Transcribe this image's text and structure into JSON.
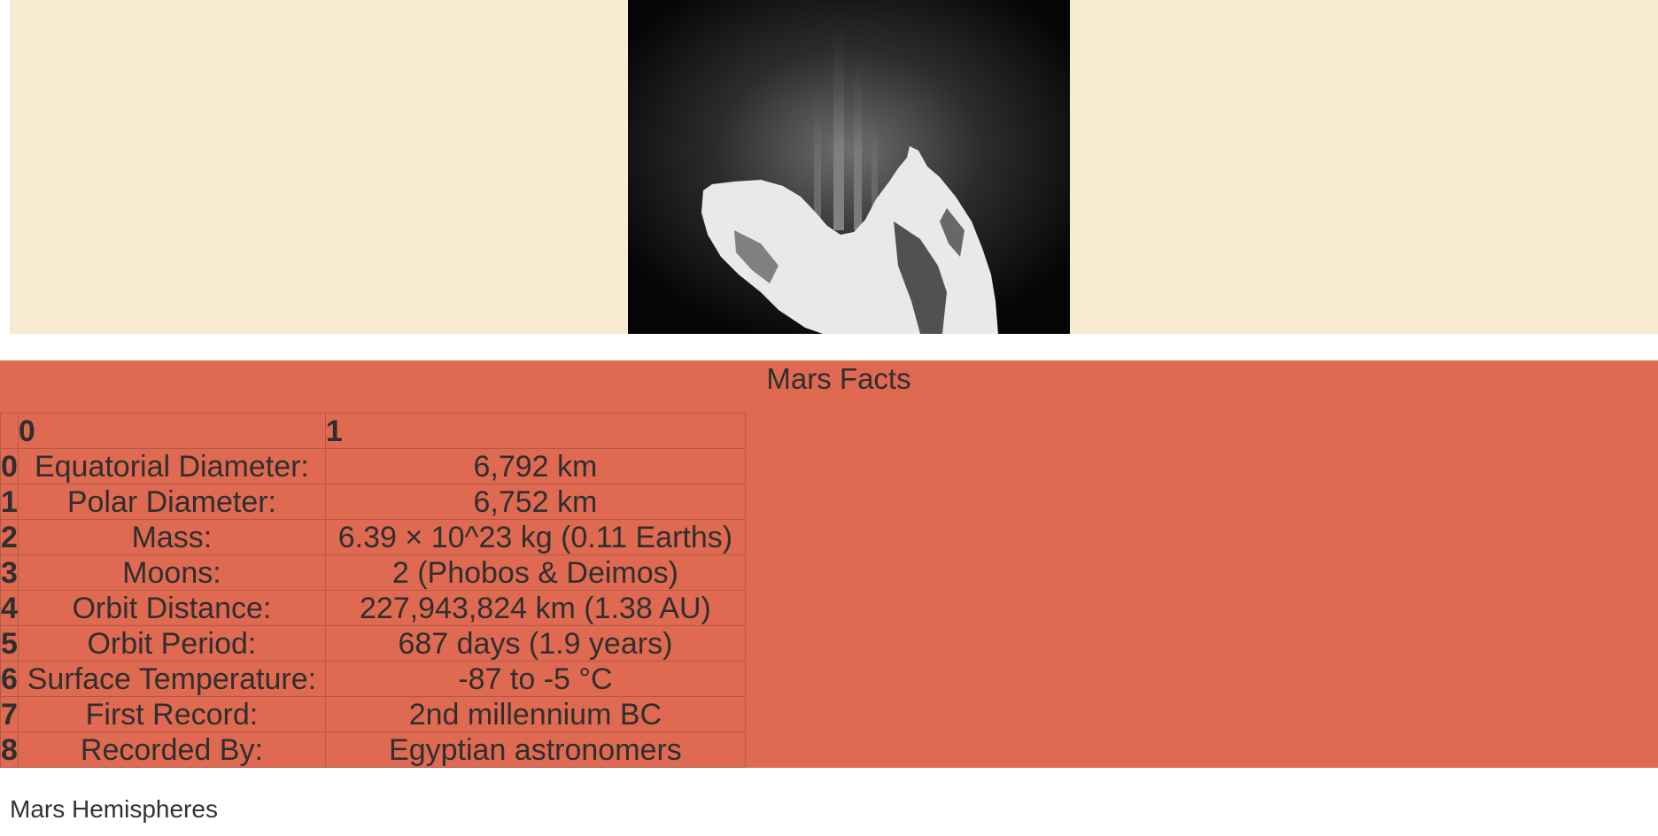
{
  "hero": {
    "image_icon": "comet-image"
  },
  "facts": {
    "title": "Mars Facts",
    "columns": [
      "",
      "0",
      "1"
    ],
    "rows": [
      {
        "index": "0",
        "label": "Equatorial Diameter:",
        "value": "6,792 km"
      },
      {
        "index": "1",
        "label": "Polar Diameter:",
        "value": "6,752 km"
      },
      {
        "index": "2",
        "label": "Mass:",
        "value": "6.39 × 10^23 kg (0.11 Earths)"
      },
      {
        "index": "3",
        "label": "Moons:",
        "value": "2 (Phobos & Deimos)"
      },
      {
        "index": "4",
        "label": "Orbit Distance:",
        "value": "227,943,824 km (1.38 AU)"
      },
      {
        "index": "5",
        "label": "Orbit Period:",
        "value": "687 days (1.9 years)"
      },
      {
        "index": "6",
        "label": "Surface Temperature:",
        "value": "-87 to -5 °C"
      },
      {
        "index": "7",
        "label": "First Record:",
        "value": "2nd millennium BC"
      },
      {
        "index": "8",
        "label": "Recorded By:",
        "value": "Egyptian astronomers"
      }
    ]
  },
  "hemispheres": {
    "title": "Mars Hemispheres"
  },
  "colors": {
    "hero_background": "#f7ecd2",
    "facts_background": "#df6a51",
    "text": "#333333"
  }
}
